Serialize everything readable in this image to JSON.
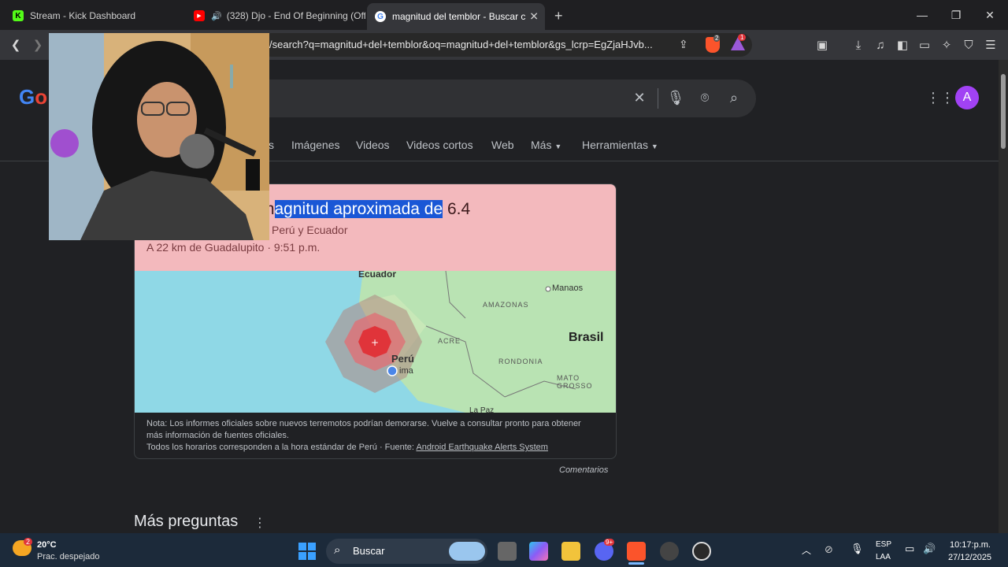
{
  "tabs": [
    {
      "title": "Stream - Kick Dashboard",
      "icon": "kick-icon",
      "favicon_letter": "K"
    },
    {
      "title": "(328) Djo - End Of Beginning (Off",
      "icon": "youtube-icon",
      "favicon_letter": "▶"
    },
    {
      "title": "magnitud del temblor - Buscar c",
      "icon": "google-icon",
      "favicon_letter": "G"
    }
  ],
  "new_tab_label": "+",
  "address_bar": {
    "url": "/search?q=magnitud+del+temblor&oq=magnitud+del+temblor&gs_lcrp=EgZjaHJvb..."
  },
  "toolbar_badges": {
    "brave_shields_count": "2",
    "rewards_count": "1"
  },
  "search_nav": {
    "partial_first": "s",
    "items": [
      "Imágenes",
      "Videos",
      "Videos cortos",
      "Web",
      "Más",
      "Herramientas"
    ]
  },
  "account_initial": "A",
  "earthquake_card": {
    "headline_highlighted": "agnitud aproximada de",
    "headline_prefix": "m",
    "headline_rest": "6.4",
    "region": "Perú y Ecuador",
    "location_time": "A 22 km de Guadalupito · 9:51 p.m.",
    "map_labels": {
      "ecuador": "Ecuador",
      "manaos": "Manaos",
      "amazonas": "AMAZONAS",
      "brasil": "Brasil",
      "acre": "ACRE",
      "peru": "Perú",
      "lima": "ima",
      "rondonia": "RONDONIA",
      "mato_grosso": "MATO GROSSO",
      "la_paz": "La Paz"
    },
    "note_line1": "Nota: Los informes oficiales sobre nuevos terremotos podrían demorarse. Vuelve a consultar pronto para obtener",
    "note_line2": "más información de fuentes oficiales.",
    "note_line3_prefix": "Todos los horarios corresponden a la hora estándar de Perú · Fuente: ",
    "source_link": "Android Earthquake Alerts System"
  },
  "comments_label": "Comentarios",
  "more_questions": "Más preguntas",
  "taskbar": {
    "weather_temp": "20°C",
    "weather_desc": "Prac. despejado",
    "weather_badge": "2",
    "search_placeholder": "Buscar",
    "discord_badge": "9+",
    "lang_top": "ESP",
    "lang_bottom": "LAA",
    "time": "10:17:p.m.",
    "date": "27/12/2025"
  },
  "colors": {
    "card_header": "#f3b9bd",
    "highlight": "#1a57d6",
    "map_water": "#8fd8e6",
    "map_land": "#b9e3b3",
    "quake_red": "#e0343a",
    "account_purple": "#a142f4"
  }
}
